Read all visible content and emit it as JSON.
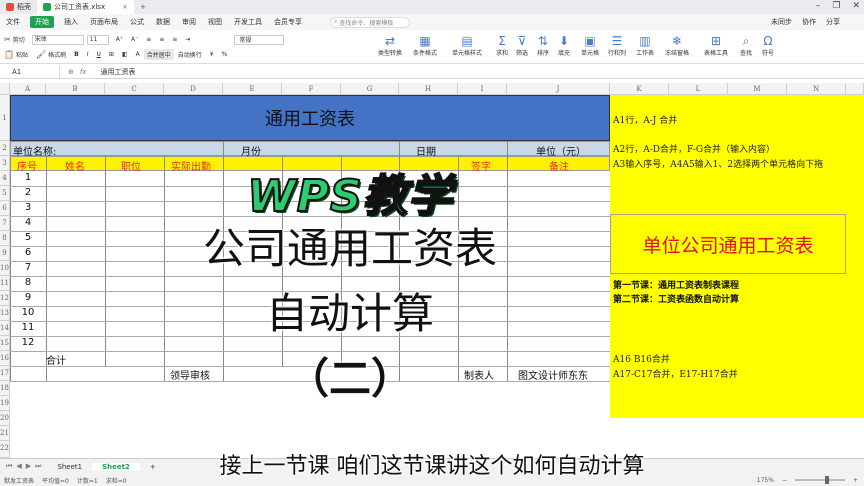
{
  "titlebar": {
    "tabs": [
      {
        "label": "稻壳",
        "icon": "wps-logo-icon",
        "color": "#e84c3d"
      },
      {
        "label": "公司工资表.xlsx",
        "icon": "sheet-file-icon",
        "color": "#20a053"
      }
    ],
    "new_tab": "+"
  },
  "menubar": {
    "items": [
      "文件",
      "开始",
      "插入",
      "页面布局",
      "公式",
      "数据",
      "审阅",
      "视图",
      "开发工具",
      "会员专享"
    ],
    "search_placeholder": "查找命令、搜索模板",
    "right_items": [
      "未同步",
      "协作",
      "分享"
    ]
  },
  "toolbar": {
    "row1": [
      "剪切",
      "宋体",
      "11"
    ],
    "row2": [
      "粘贴",
      "格式刷"
    ],
    "font_name": "宋体",
    "font_size": "11",
    "merge_label": "合并居中",
    "wrap_label": "自动换行",
    "format_label": "常规",
    "big_buttons": [
      "类型转换",
      "条件格式",
      "单元格样式",
      "求和",
      "筛选",
      "排序",
      "填充",
      "单元格",
      "行和列",
      "工作表",
      "冻结窗格",
      "表格工具",
      "查找",
      "符号"
    ]
  },
  "formula_bar": {
    "cell_ref": "A1",
    "content": "通用工资表"
  },
  "columns": [
    "A",
    "B",
    "C",
    "D",
    "E",
    "F",
    "G",
    "H",
    "I",
    "J",
    "K",
    "L",
    "M",
    "N"
  ],
  "rows": [
    "1",
    "2",
    "3",
    "4",
    "5",
    "6",
    "7",
    "8",
    "9",
    "10",
    "11",
    "12",
    "13",
    "14",
    "15",
    "16",
    "17",
    "18",
    "19",
    "20",
    "21",
    "22"
  ],
  "sheet": {
    "title": "通用工资表",
    "unit_label": "单位名称:",
    "month_label": "月份",
    "date_label": "日期",
    "unit_yuan": "单位（元）",
    "headers": [
      "序号",
      "姓名",
      "职位",
      "实际出勤",
      "",
      "",
      "",
      "签字",
      "备注"
    ],
    "serials": [
      "1",
      "2",
      "3",
      "4",
      "5",
      "6",
      "7",
      "8",
      "9",
      "10",
      "11",
      "12"
    ],
    "total_label": "合计",
    "review_label": "领导审核",
    "maker_label": "制表人",
    "maker_name": "图文设计师东东"
  },
  "notes": {
    "k1": "A1行，A-J 合并",
    "k2": "A2行，A-D合并，F-G合并（输入内容）",
    "k3": "A3输入序号，A4A5输入1、2选择两个单元格向下拖",
    "box": "单位公司通用工资表",
    "lesson1": "第一节课：通用工资表制表课程",
    "lesson2": "第二节课：工资表函数自动计算",
    "k16": "A16 B16合并",
    "k17": "A17-C17合并，E17-H17合并"
  },
  "overlay": {
    "wps": "WPS教学",
    "line1": "公司通用工资表",
    "line2": "自动计算",
    "line3": "（二）"
  },
  "sheet_tabs": [
    "Sheet1",
    "Sheet2"
  ],
  "active_sheet": "Sheet2",
  "status": {
    "app": "默发工资表",
    "avg": "平均值=0",
    "count": "计数=1",
    "sum": "求和=0",
    "zoom": "175%"
  },
  "subtitle": "接上一节课 咱们这节课讲这个如何自动计算",
  "colors": {
    "title_blue": "#4472c4",
    "header_yellow": "#fff200",
    "header_red": "#e0301e",
    "wps_green": "#2ecc71"
  }
}
